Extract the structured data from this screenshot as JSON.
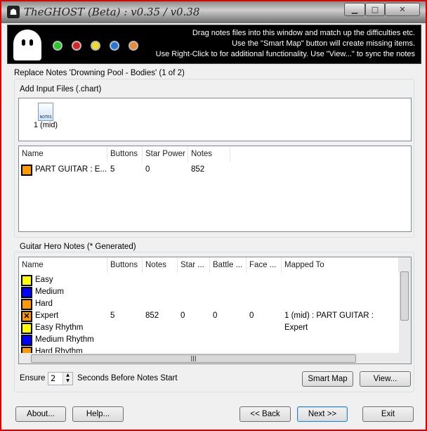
{
  "window": {
    "title": "TheGHOST (Beta) : v0.35 / v0.38",
    "minimize": "▁",
    "maximize": "□",
    "close": "✕"
  },
  "banner": {
    "lines": [
      "Drag notes files into this window and match up the difficulties etc.",
      "Use the \"Smart Map\" button will create missing items.",
      "Use Right-Click to for additional functionality. Use \"View...\" to sync the notes"
    ],
    "dots": [
      "#22cc22",
      "#dd2222",
      "#eedd22",
      "#2277dd",
      "#ee8833"
    ]
  },
  "replace_title": "Replace Notes 'Drowning Pool - Bodies' (1 of 2)",
  "input_files": {
    "title": "Add Input Files (.chart)",
    "files": [
      {
        "label": "1 (mid)",
        "icon_text": "NOTES"
      }
    ]
  },
  "input_table": {
    "columns": [
      "Name",
      "Buttons",
      "Star Power",
      "Notes"
    ],
    "rows": [
      {
        "color": "#ff9900",
        "name": "PART GUITAR : E...",
        "buttons": "5",
        "star_power": "0",
        "notes": "852"
      }
    ]
  },
  "gh_notes": {
    "title": "Guitar Hero Notes (* Generated)",
    "columns": [
      "Name",
      "Buttons",
      "Notes",
      "Star ...",
      "Battle ...",
      "Face ...",
      "Mapped To"
    ],
    "rows": [
      {
        "color": "#ffff00",
        "name": "Easy",
        "buttons": "",
        "notes": "",
        "star": "",
        "battle": "",
        "face": "",
        "mapped": "",
        "mark": ""
      },
      {
        "color": "#0000ff",
        "name": "Medium",
        "buttons": "",
        "notes": "",
        "star": "",
        "battle": "",
        "face": "",
        "mapped": "",
        "mark": ""
      },
      {
        "color": "#ff9900",
        "name": "Hard",
        "buttons": "",
        "notes": "",
        "star": "",
        "battle": "",
        "face": "",
        "mapped": "",
        "mark": ""
      },
      {
        "color": "#ff9900",
        "name": "Expert",
        "buttons": "5",
        "notes": "852",
        "star": "0",
        "battle": "0",
        "face": "0",
        "mapped": "1 (mid) : PART GUITAR : Expert",
        "mark": "✕"
      },
      {
        "color": "#ffff00",
        "name": "Easy Rhythm",
        "buttons": "",
        "notes": "",
        "star": "",
        "battle": "",
        "face": "",
        "mapped": "",
        "mark": ""
      },
      {
        "color": "#0000ff",
        "name": "Medium Rhythm",
        "buttons": "",
        "notes": "",
        "star": "",
        "battle": "",
        "face": "",
        "mapped": "",
        "mark": ""
      },
      {
        "color": "#ff9900",
        "name": "Hard Rhythm",
        "buttons": "",
        "notes": "",
        "star": "",
        "battle": "",
        "face": "",
        "mapped": "",
        "mark": ""
      }
    ]
  },
  "ensure": {
    "prefix": "Ensure",
    "value": "2",
    "suffix": "Seconds Before Notes Start"
  },
  "buttons": {
    "smart_map": "Smart Map",
    "view": "View...",
    "about": "About...",
    "help": "Help...",
    "back": "<< Back",
    "next": "Next >>",
    "exit": "Exit"
  }
}
